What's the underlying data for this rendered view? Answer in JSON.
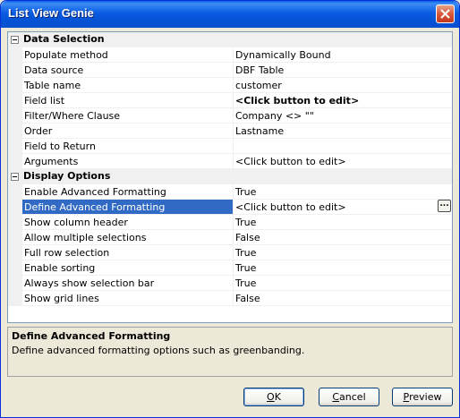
{
  "window": {
    "title": "List View Genie"
  },
  "grid": {
    "categories": [
      {
        "label": "Data Selection",
        "rows": [
          {
            "name": "Populate method",
            "value": "Dynamically Bound",
            "bold": false
          },
          {
            "name": "Data source",
            "value": "DBF Table",
            "bold": false
          },
          {
            "name": "Table name",
            "value": "customer",
            "bold": false
          },
          {
            "name": "Field list",
            "value": "<Click button to edit>",
            "bold": true
          },
          {
            "name": "Filter/Where Clause",
            "value": "Company <> \"\"",
            "bold": false
          },
          {
            "name": "Order",
            "value": "Lastname",
            "bold": false
          },
          {
            "name": "Field to Return",
            "value": "",
            "bold": false
          },
          {
            "name": "Arguments",
            "value": "<Click button to edit>",
            "bold": false
          }
        ]
      },
      {
        "label": "Display Options",
        "rows": [
          {
            "name": "Enable Advanced Formatting",
            "value": "True",
            "bold": false
          },
          {
            "name": "Define Advanced Formatting",
            "value": "<Click button to edit>",
            "bold": false,
            "selected": true,
            "ellipsis": "..."
          },
          {
            "name": "Show column header",
            "value": "True",
            "bold": false
          },
          {
            "name": "Allow multiple selections",
            "value": "False",
            "bold": false
          },
          {
            "name": "Full row selection",
            "value": "True",
            "bold": false
          },
          {
            "name": "Enable sorting",
            "value": "True",
            "bold": false
          },
          {
            "name": "Always show selection bar",
            "value": "True",
            "bold": false
          },
          {
            "name": "Show grid lines",
            "value": "False",
            "bold": false
          }
        ]
      }
    ]
  },
  "description": {
    "title": "Define Advanced Formatting",
    "text": "Define advanced formatting options such as greenbanding."
  },
  "buttons": {
    "ok": {
      "pre": "",
      "key": "O",
      "post": "K"
    },
    "cancel": {
      "pre": "",
      "key": "C",
      "post": "ancel"
    },
    "preview": {
      "pre": "",
      "key": "P",
      "post": "review"
    }
  },
  "colors": {
    "titlebar": "#0553d6",
    "selection": "#316ac5",
    "window_bg": "#ece9d8"
  }
}
